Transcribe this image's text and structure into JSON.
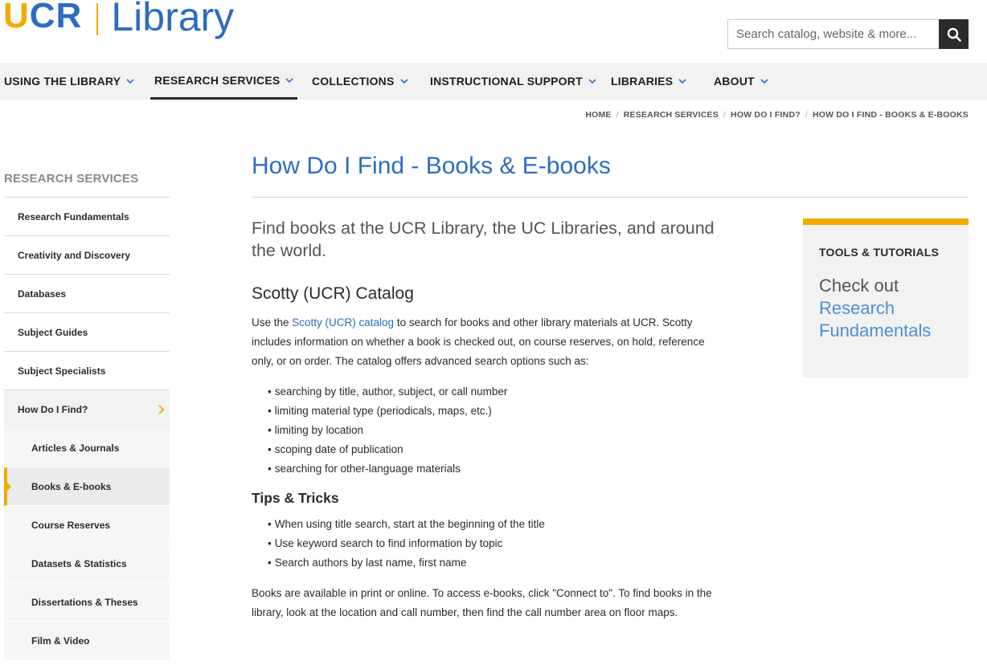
{
  "logo": {
    "u": "U",
    "cr": "CR",
    "library": "Library"
  },
  "search": {
    "placeholder": "Search catalog, website & more..."
  },
  "nav": [
    {
      "label": "Using the Library"
    },
    {
      "label": "Research Services"
    },
    {
      "label": "Collections"
    },
    {
      "label": "Instructional Support"
    },
    {
      "label": "Libraries"
    },
    {
      "label": "About"
    }
  ],
  "breadcrumb": [
    "HOME",
    "RESEARCH SERVICES",
    "HOW DO I FIND?",
    "HOW DO I FIND - BOOKS & E-BOOKS"
  ],
  "sidebar": {
    "title": "RESEARCH SERVICES",
    "items": [
      "Research Fundamentals",
      "Creativity and Discovery",
      "Databases",
      "Subject Guides",
      "Subject Specialists",
      "How Do I Find?"
    ],
    "sub_items": [
      "Articles & Journals",
      "Books & E-books",
      "Course Reserves",
      "Datasets & Statistics",
      "Dissertations & Theses",
      "Film & Video"
    ]
  },
  "main": {
    "title": "How Do I Find - Books & E-books",
    "lede": "Find books at the UCR Library, the UC Libraries, and around the world.",
    "section1_heading": "Scotty (UCR) Catalog",
    "para1_pre": "Use the ",
    "para1_link": "Scotty (UCR) catalog",
    "para1_post": " to search for books and other library materials at UCR. Scotty includes information on whether a book is checked out, on course reserves, on hold, reference only, or on order. The catalog offers advanced search options such as:",
    "bullets1": [
      "searching by title, author, subject, or call number",
      "limiting material type (periodicals, maps, etc.)",
      "limiting by location",
      "scoping date of publication",
      "searching for other-language materials"
    ],
    "section2_heading": "Tips & Tricks",
    "bullets2": [
      "When using title search, start at the beginning of the title",
      "Use keyword search to find information by topic",
      "Search authors by last name, first name"
    ],
    "para2": "Books are available in print or online. To access e-books, click \"Connect to\". To find books in the library, look at the location and call number, then find the call number area on floor maps."
  },
  "tools": {
    "title": "TOOLS & TUTORIALS",
    "text": "Check out",
    "link": "Research Fundamentals"
  }
}
